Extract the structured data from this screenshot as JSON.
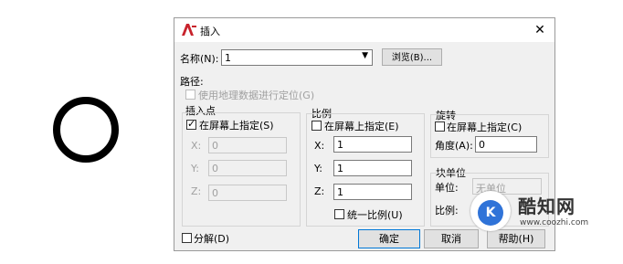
{
  "window": {
    "title": "插入",
    "app_icon": "autocad-icon",
    "close_glyph": "✕"
  },
  "name_row": {
    "label": "名称(N):",
    "value": "1",
    "browse_label": "浏览(B)..."
  },
  "path": {
    "label": "路径:",
    "geo_label": "使用地理数据进行定位(G)"
  },
  "insertion": {
    "title": "插入点",
    "specify_label": "在屏幕上指定(S)",
    "specify_checked": true,
    "x_label": "X:",
    "x_value": "0",
    "y_label": "Y:",
    "y_value": "0",
    "z_label": "Z:",
    "z_value": "0"
  },
  "scale": {
    "title": "比例",
    "specify_label": "在屏幕上指定(E)",
    "specify_checked": false,
    "x_label": "X:",
    "x_value": "1",
    "y_label": "Y:",
    "y_value": "1",
    "z_label": "Z:",
    "z_value": "1",
    "uniform_label": "统一比例(U)",
    "uniform_checked": false
  },
  "rotation": {
    "title": "旋转",
    "specify_label": "在屏幕上指定(C)",
    "specify_checked": false,
    "angle_label": "角度(A):",
    "angle_value": "0"
  },
  "block_unit": {
    "title": "块单位",
    "unit_label": "单位:",
    "unit_value": "无单位",
    "scale_label": "比例:"
  },
  "explode": {
    "label": "分解(D)",
    "checked": false
  },
  "buttons": {
    "ok": "确定",
    "cancel": "取消",
    "help": "帮助(H)"
  },
  "watermark": {
    "logo_text": "K",
    "name": "酷知网",
    "url": "www.coozhi.com"
  }
}
